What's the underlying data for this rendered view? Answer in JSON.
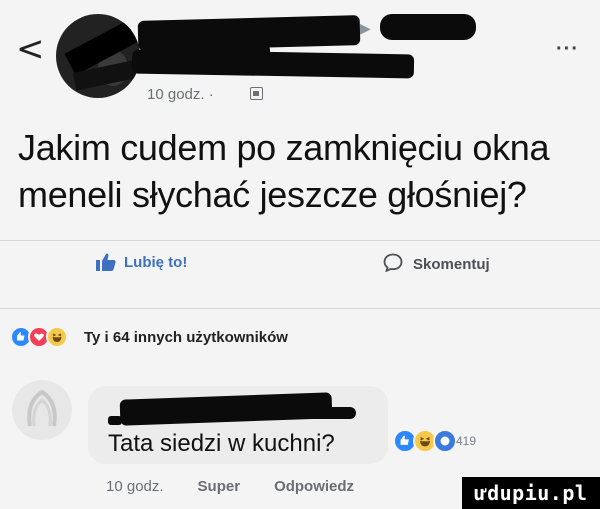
{
  "header": {
    "back_glyph": "<",
    "timestamp": "10 godz. ·",
    "more_glyph": "···",
    "play_glyph": "▶"
  },
  "post": {
    "text": "Jakim cudem po zamknięciu okna meneli słychać jeszcze głośniej?"
  },
  "actions": {
    "like_label": "Lubię to!",
    "comment_label": "Skomentuj"
  },
  "reactions_summary": {
    "text": "Ty i 64 innych użytkowników",
    "icons": [
      "like-icon",
      "love-icon",
      "haha-icon"
    ]
  },
  "comment": {
    "text": "Tata siedzi w kuchni?",
    "reaction_count": "419",
    "reaction_icons": [
      "like-icon",
      "haha-icon",
      "love-icon"
    ],
    "time": "10 godz.",
    "like_label": "Super",
    "reply_label": "Odpowiedz"
  },
  "watermark": "ưdupiu.pl",
  "colors": {
    "like_blue": "#3f6fbf",
    "love_red": "#f33e58",
    "haha_yellow": "#f7c94a",
    "background": "#f4f4f4"
  }
}
